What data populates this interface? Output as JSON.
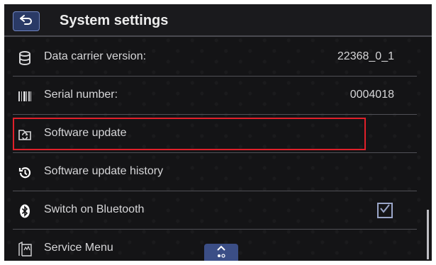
{
  "header": {
    "title": "System settings"
  },
  "rows": [
    {
      "label": "Data carrier version:",
      "value": "22368_0_1",
      "icon": "database-icon"
    },
    {
      "label": "Serial number:",
      "value": "0004018",
      "icon": "barcode-icon"
    },
    {
      "label": "Software update",
      "icon": "folder-sync-icon"
    },
    {
      "label": "Software update history",
      "icon": "history-icon"
    },
    {
      "label": "Switch on Bluetooth",
      "icon": "bluetooth-icon",
      "checked": true
    },
    {
      "label": "Service Menu",
      "icon": "service-menu-icon"
    }
  ],
  "colors": {
    "background": "#141416",
    "accent": "#3b4e86",
    "highlight": "#e0202a",
    "text": "#d6d6d8"
  }
}
